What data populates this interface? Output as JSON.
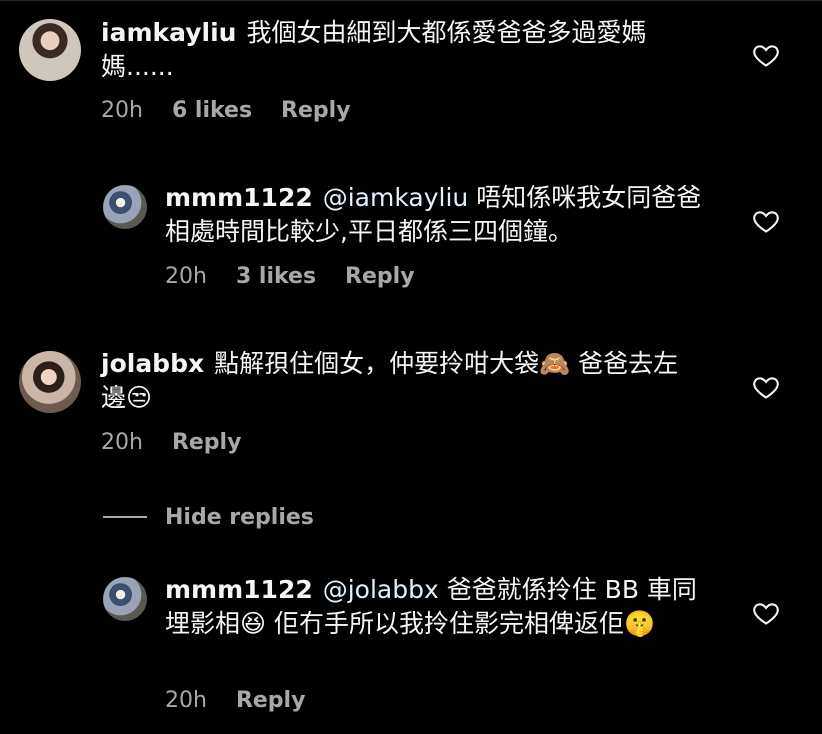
{
  "comments": [
    {
      "username": "iamkayliu",
      "body": "我個女由細到大都係愛爸爸多過愛媽媽......",
      "time": "20h",
      "likes": "6 likes",
      "reply": "Reply"
    },
    {
      "username": "mmm1122",
      "mention": "@iamkayliu",
      "body": " 唔知係咪我女同爸爸相處時間比較少,平日都係三四個鐘。",
      "time": "20h",
      "likes": "3 likes",
      "reply": "Reply"
    },
    {
      "username": "jolabbx",
      "body": "點解孭住個女，仲要拎咁大袋🙈 爸爸去左邊😒",
      "time": "20h",
      "reply": "Reply"
    },
    {
      "username": "mmm1122",
      "mention": "@jolabbx",
      "body": " 爸爸就係拎住 BB 車同埋影相😆 佢冇手所以我拎住影完相俾返佢🤫",
      "time": "20h",
      "reply": "Reply"
    }
  ],
  "hide_replies_label": "Hide replies",
  "colors": {
    "background": "#000000",
    "text": "#f5f5f5",
    "meta": "#a8a8a8",
    "mention": "#e0f1ff"
  },
  "icons": {
    "like": "heart-outline-icon"
  }
}
